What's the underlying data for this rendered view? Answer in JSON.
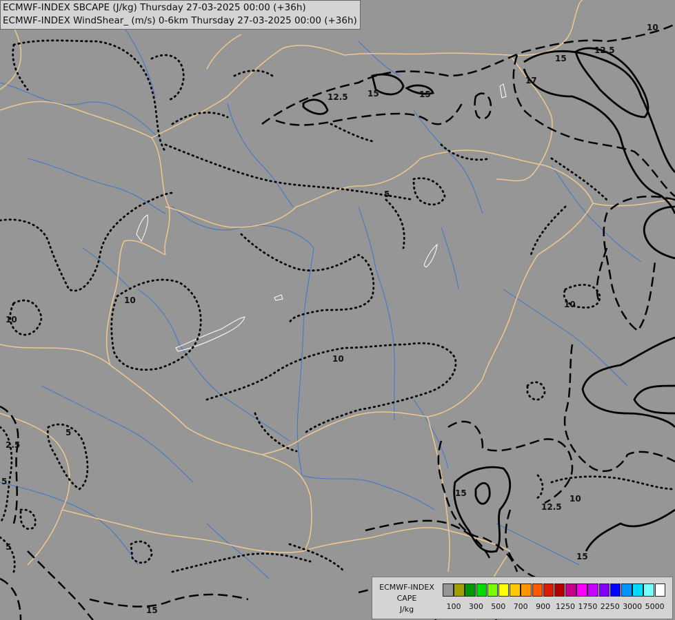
{
  "title": {
    "line1": "ECMWF-INDEX SBCAPE (J/kg) Thursday 27-03-2025 00:00 (+36h)",
    "line2": "ECMWF-INDEX WindShear_ (m/s) 0-6km Thursday 27-03-2025 00:00 (+36h)"
  },
  "legend": {
    "line1": "ECMWF-INDEX",
    "line2": "CAPE",
    "line3": "J/kg",
    "colors": [
      "#969696",
      "#a0a000",
      "#009600",
      "#00dc00",
      "#78ff00",
      "#ffff00",
      "#ffc800",
      "#ff9600",
      "#ff5a00",
      "#dc1e00",
      "#b40000",
      "#c8008c",
      "#ff00ff",
      "#c800ff",
      "#8200ff",
      "#0000ff",
      "#0096ff",
      "#00dcff",
      "#78ffff",
      "#ffffff"
    ],
    "ticks": [
      "100",
      "300",
      "500",
      "700",
      "900",
      "1250",
      "1750",
      "2250",
      "3000",
      "5000"
    ]
  },
  "contour_labels": [
    "10",
    "12.5",
    "15",
    "12.5",
    "15",
    "17",
    "15",
    "2.5",
    "5",
    "10",
    "10",
    "10",
    "5",
    "5",
    "10",
    "5",
    "15",
    "12.5",
    "10",
    "15",
    "15"
  ],
  "colors": {
    "background": "#969696",
    "border": "#f0c890",
    "river": "#3c78c8",
    "lake": "#ffffff",
    "contour": "#000000"
  }
}
